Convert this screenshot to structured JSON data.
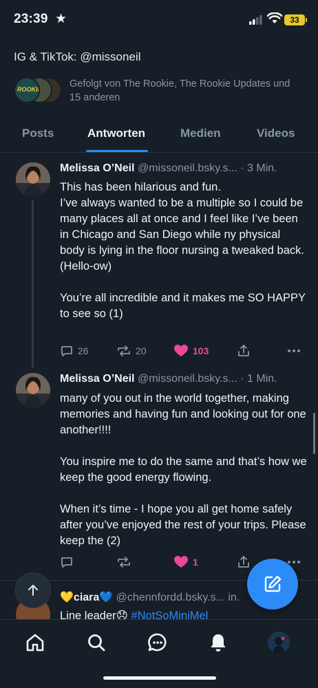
{
  "status_bar": {
    "time": "23:39",
    "battery": "33"
  },
  "profile": {
    "bio": "IG & TikTok: @missoneil",
    "followed_by": "Gefolgt von The Rookie, The Rookie Updates und 15 anderen",
    "followed_avatar_label": "ROOKIE"
  },
  "tabs": [
    "Posts",
    "Antworten",
    "Medien",
    "Videos"
  ],
  "active_tab": "Antworten",
  "posts": [
    {
      "author": "Melissa O’Neil",
      "handle": "@missoneil.bsky.s...",
      "time": "· 3 Min.",
      "text": "This has been hilarious and fun.\nI’ve always wanted to be a multiple so I could be many places all at once and I feel like I’ve been in Chicago and San Diego while ny physical body is lying in the floor nursing a tweaked back.\n(Hello-ow)\n\nYou’re all incredible and it makes me SO HAPPY to see so (1)",
      "replies": "26",
      "reposts": "20",
      "likes": "103"
    },
    {
      "author": "Melissa O’Neil",
      "handle": "@missoneil.bsky.s...",
      "time": "· 1 Min.",
      "text": "many of you out in the world together, making memories and having fun and looking out for one another!!!!\n\nYou inspire me to do the same and that’s how we keep the good energy flowing.\n\nWhen it’s time - I hope you all get home safely after you’ve enjoyed the rest of your trips. Please keep the (2)",
      "replies": "",
      "reposts": "",
      "likes": "1"
    }
  ],
  "next_post": {
    "author": "💛ciara💙",
    "handle": "@chennfordd.bsky.s...",
    "time": "in.",
    "text": "Line leader😞",
    "hashtag": "#NotSoMiniMel"
  },
  "colors": {
    "background": "#161e27",
    "accent": "#2c8bf7",
    "like": "#ec4899",
    "muted": "#8897a6"
  },
  "icons": {
    "fab": "compose-icon",
    "nav": [
      "home-icon",
      "search-icon",
      "chat-icon",
      "bell-icon",
      "profile-avatar"
    ]
  }
}
